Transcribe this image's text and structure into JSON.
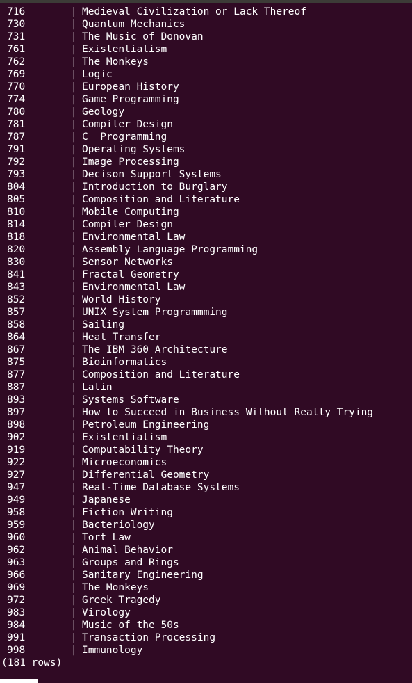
{
  "terminal": {
    "background": "#300a24",
    "foreground": "#ffffff",
    "separator": "|",
    "rows": [
      {
        "id": "716",
        "title": "Medieval Civilization or Lack Thereof"
      },
      {
        "id": "730",
        "title": "Quantum Mechanics"
      },
      {
        "id": "731",
        "title": "The Music of Donovan"
      },
      {
        "id": "761",
        "title": "Existentialism"
      },
      {
        "id": "762",
        "title": "The Monkeys"
      },
      {
        "id": "769",
        "title": "Logic"
      },
      {
        "id": "770",
        "title": "European History"
      },
      {
        "id": "774",
        "title": "Game Programming"
      },
      {
        "id": "780",
        "title": "Geology"
      },
      {
        "id": "781",
        "title": "Compiler Design"
      },
      {
        "id": "787",
        "title": "C  Programming"
      },
      {
        "id": "791",
        "title": "Operating Systems"
      },
      {
        "id": "792",
        "title": "Image Processing"
      },
      {
        "id": "793",
        "title": "Decison Support Systems"
      },
      {
        "id": "804",
        "title": "Introduction to Burglary"
      },
      {
        "id": "805",
        "title": "Composition and Literature"
      },
      {
        "id": "810",
        "title": "Mobile Computing"
      },
      {
        "id": "814",
        "title": "Compiler Design"
      },
      {
        "id": "818",
        "title": "Environmental Law"
      },
      {
        "id": "820",
        "title": "Assembly Language Programming"
      },
      {
        "id": "830",
        "title": "Sensor Networks"
      },
      {
        "id": "841",
        "title": "Fractal Geometry"
      },
      {
        "id": "843",
        "title": "Environmental Law"
      },
      {
        "id": "852",
        "title": "World History"
      },
      {
        "id": "857",
        "title": "UNIX System Programmming"
      },
      {
        "id": "858",
        "title": "Sailing"
      },
      {
        "id": "864",
        "title": "Heat Transfer"
      },
      {
        "id": "867",
        "title": "The IBM 360 Architecture"
      },
      {
        "id": "875",
        "title": "Bioinformatics"
      },
      {
        "id": "877",
        "title": "Composition and Literature"
      },
      {
        "id": "887",
        "title": "Latin"
      },
      {
        "id": "893",
        "title": "Systems Software"
      },
      {
        "id": "897",
        "title": "How to Succeed in Business Without Really Trying"
      },
      {
        "id": "898",
        "title": "Petroleum Engineering"
      },
      {
        "id": "902",
        "title": "Existentialism"
      },
      {
        "id": "919",
        "title": "Computability Theory"
      },
      {
        "id": "922",
        "title": "Microeconomics"
      },
      {
        "id": "927",
        "title": "Differential Geometry"
      },
      {
        "id": "947",
        "title": "Real-Time Database Systems"
      },
      {
        "id": "949",
        "title": "Japanese"
      },
      {
        "id": "958",
        "title": "Fiction Writing"
      },
      {
        "id": "959",
        "title": "Bacteriology"
      },
      {
        "id": "960",
        "title": "Tort Law"
      },
      {
        "id": "962",
        "title": "Animal Behavior"
      },
      {
        "id": "963",
        "title": "Groups and Rings"
      },
      {
        "id": "966",
        "title": "Sanitary Engineering"
      },
      {
        "id": "969",
        "title": "The Monkeys"
      },
      {
        "id": "972",
        "title": "Greek Tragedy"
      },
      {
        "id": "983",
        "title": "Virology"
      },
      {
        "id": "984",
        "title": "Music of the 50s"
      },
      {
        "id": "991",
        "title": "Transaction Processing"
      },
      {
        "id": "998",
        "title": "Immunology"
      }
    ],
    "row_count_text": "(181 rows)"
  }
}
